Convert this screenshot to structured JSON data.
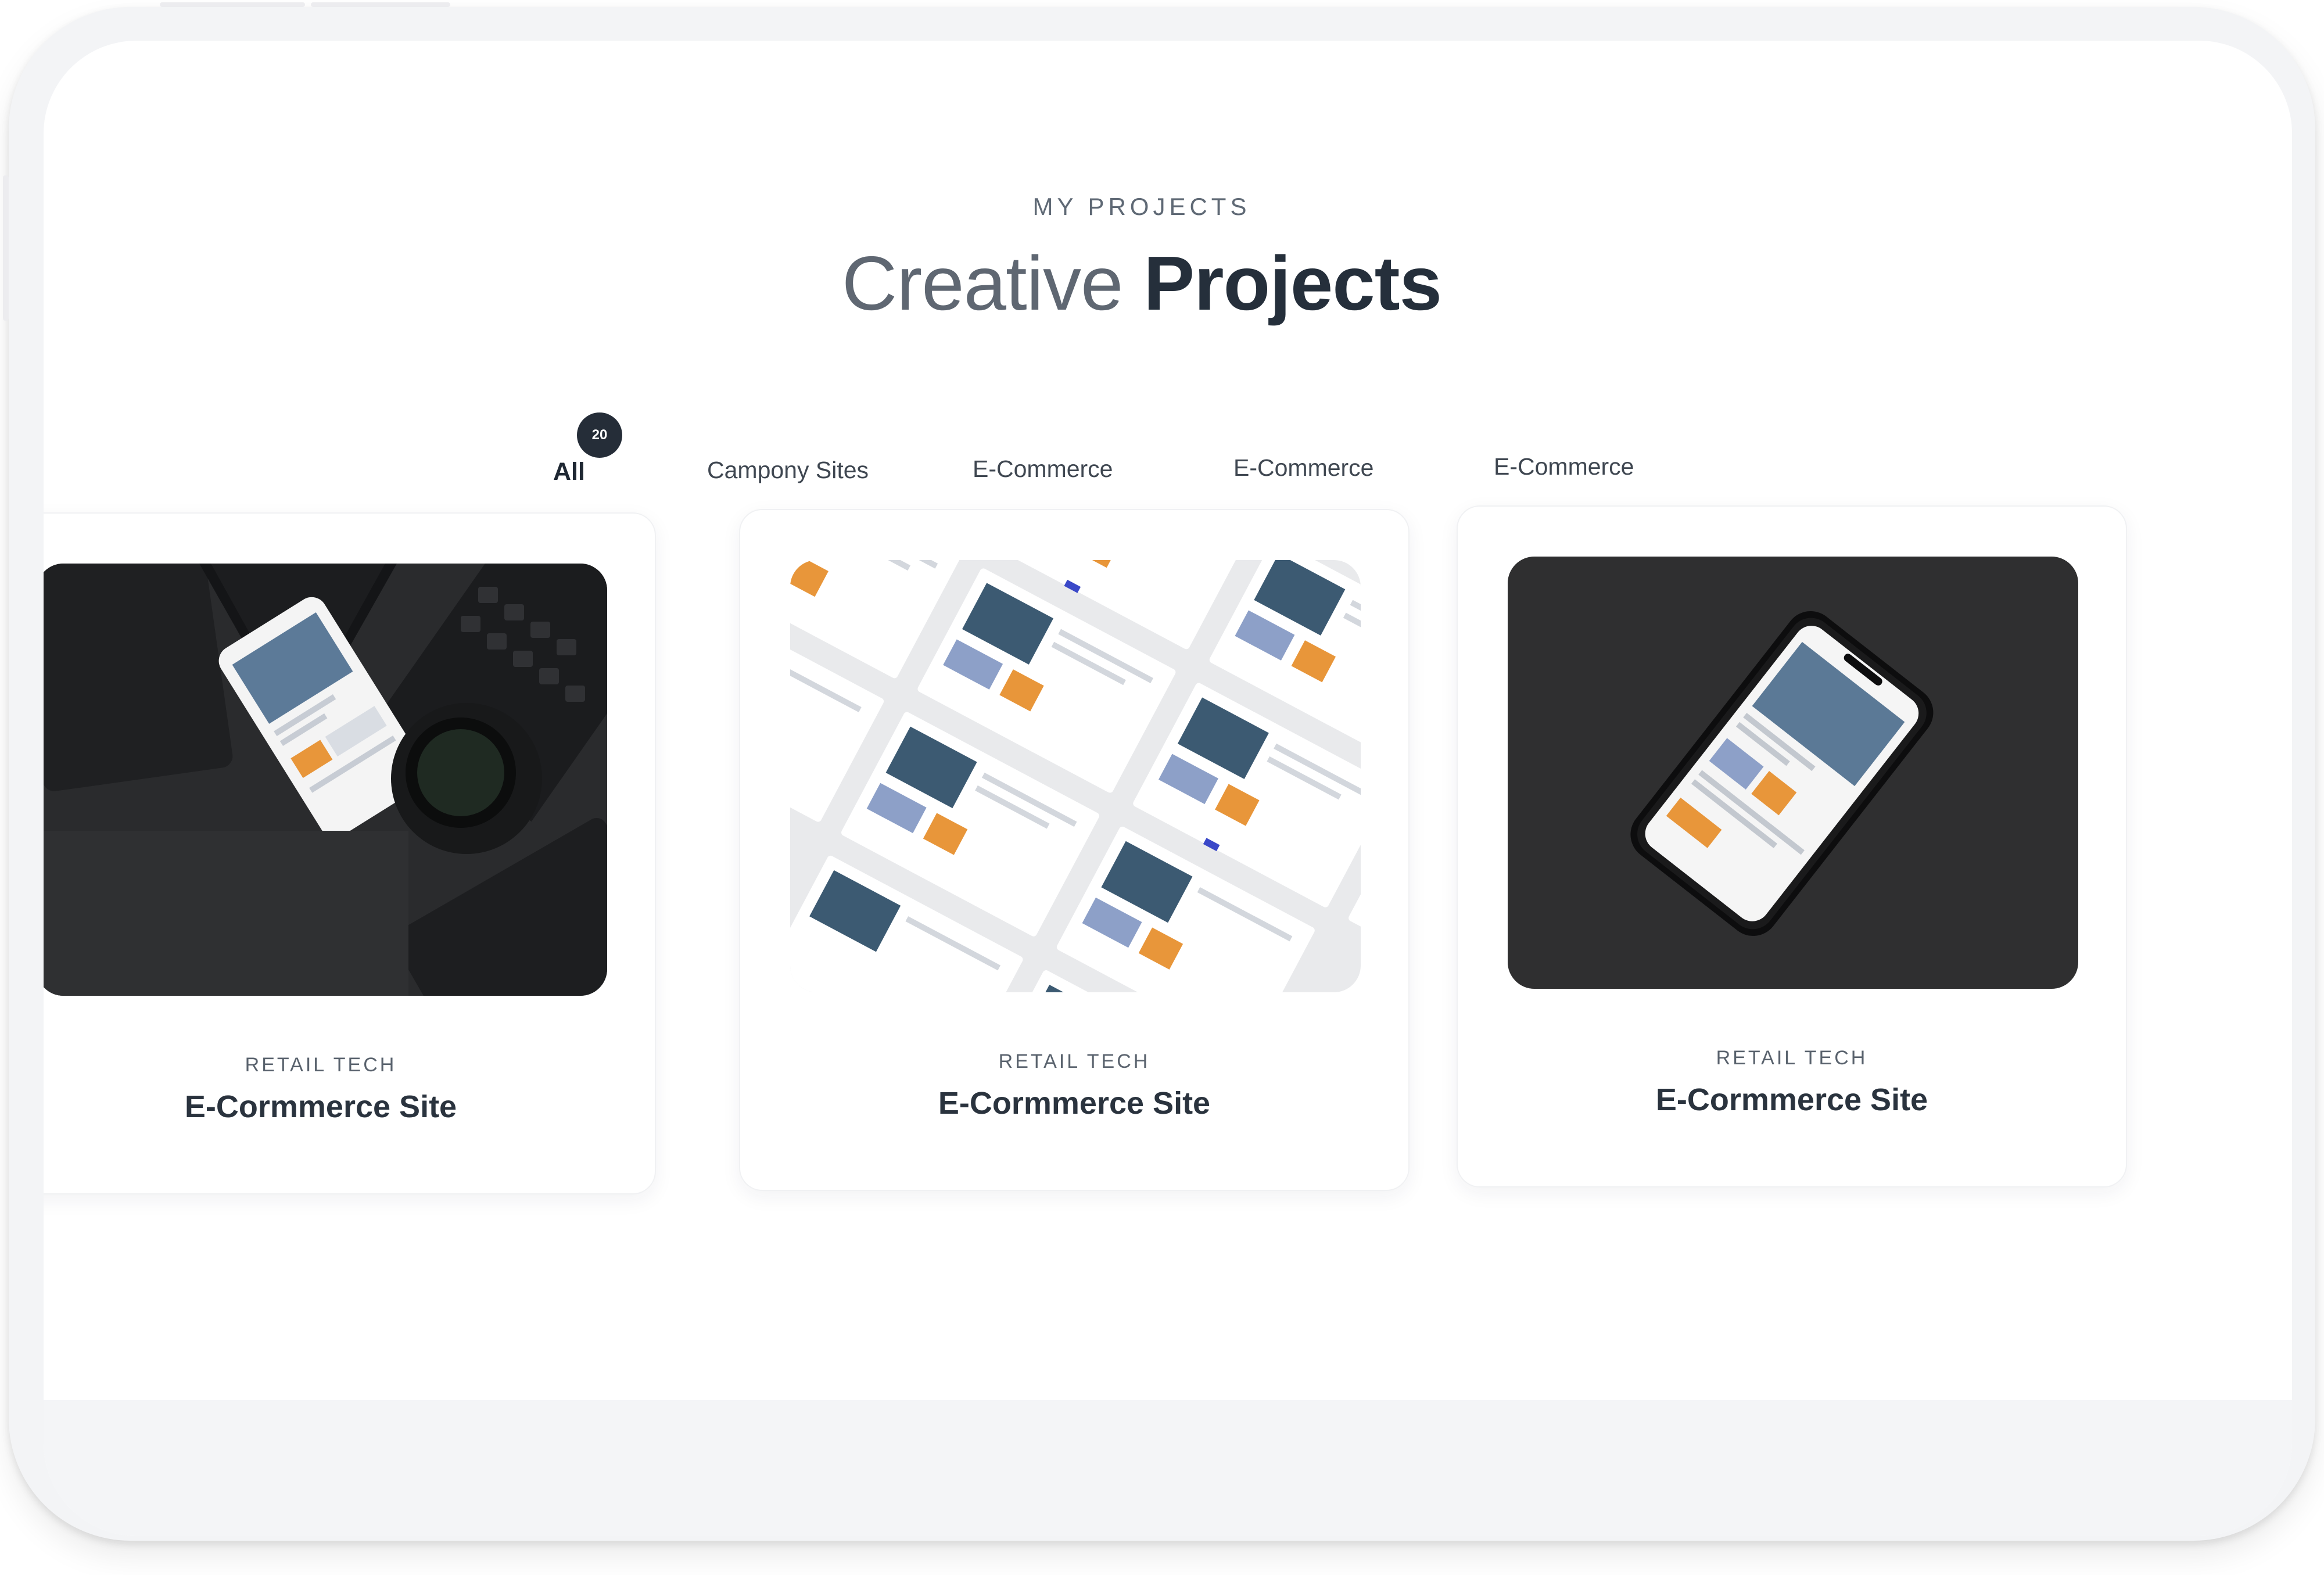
{
  "section": {
    "eyebrow": "MY PROJECTS",
    "title_light": "Creative",
    "title_bold": "Projects"
  },
  "filters": {
    "all_label": "All",
    "all_count": "20",
    "tabs": [
      "Campony Sites",
      "E-Commerce",
      "E-Commerce",
      "E-Commerce"
    ]
  },
  "projects": [
    {
      "category": "RETAIL TECH",
      "title": "E-Cormmerce Site"
    },
    {
      "category": "RETAIL TECH",
      "title": "E-Cormmerce Site"
    },
    {
      "category": "RETAIL TECH",
      "title": "E-Cormmerce Site"
    }
  ],
  "colors": {
    "heading_dark": "#252f3b",
    "badge_bg": "#252d38",
    "accent_orange": "#e8963a",
    "accent_blue": "#3a48c8"
  }
}
